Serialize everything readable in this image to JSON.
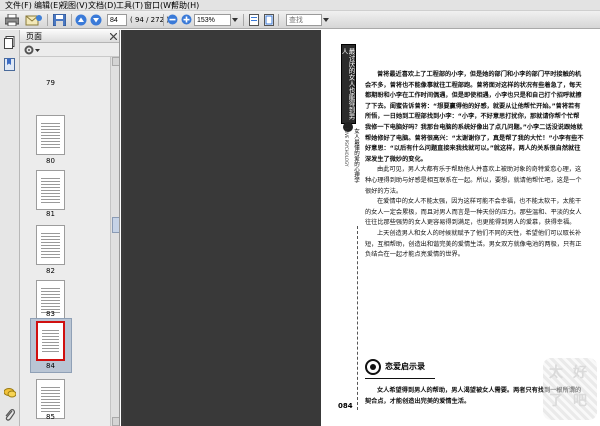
{
  "menu": [
    {
      "label": "文件(F)"
    },
    {
      "label": "编辑(E)"
    },
    {
      "label": "视图(V)"
    },
    {
      "label": "文档(D)"
    },
    {
      "label": "工具(T)"
    },
    {
      "label": "窗口(W)"
    },
    {
      "label": "帮助(H)"
    }
  ],
  "toolbar": {
    "page_current": "84",
    "page_total": "( 94 / 272 )",
    "zoom": "153%",
    "find_placeholder": "查找"
  },
  "panel": {
    "title": "页面",
    "thumbnails": [
      {
        "label": "79"
      },
      {
        "label": "80"
      },
      {
        "label": "81"
      },
      {
        "label": "82"
      },
      {
        "label": "83"
      },
      {
        "label": "84"
      },
      {
        "label": "85"
      }
    ],
    "selected_index": 5
  },
  "page": {
    "vertical_title": "最讨厌的女人也能得到男人",
    "vertical_subtitle": "女人最懂的爱的心理学",
    "vertical_subtitle_en": "LOVE PSYCHOLOGY",
    "page_number": "084",
    "paragraphs": [
      {
        "text": "曾将最近喜欢上了工程部的小李，但是她的部门和小李的部门平时接触的机会不多，曾将也不能像事就往工程部跑。曾将面对这样的状况有些着急了，每天都期盼和小李在工作时间偶遇，但是即使相遇，小李也只是和自己打个招呼就擦了下去。闺蜜告诉曾将：“想要赢得他的好感，就要从让他帮忙开始。”曾将若有所悟，一日她到工程部找到小李：“小李，不好意思打扰你，那就请你帮个忙帮我修一下电脑好吗？我那台电脑的系统好像出了点几问题。”小李二话没说跟她就帮她修好了电脑。曾将很高兴：“太谢谢你了，真是帮了我的大忙！”小李有些不好意思：“以后有什么问题直接来我找就可以。”就这样，两人的关系很自然就往深发生了微妙的变化。",
        "bold": true
      },
      {
        "text": "由此可见，男人大都有乐于帮助他人并喜欢上被助对象的奇特爱恋心理，这种心理得到助与好感是相互联系在一起。所以，要想，就请他帮忙吧，这是一个很好的方法。",
        "bold": false
      },
      {
        "text": "在爱情中的女人不能太强，因为这样可能不会幸福，也不能太软干，太能干的女人一定会累极，而且对男人而言是一种天份的压力。那些温和、平淡的女人往往比那些强势的女人更容易得到满足，也更能得到男人的爱慕，获得幸福。",
        "bold": false
      },
      {
        "text": "上天创造男人和女人的时候就赋予了他们不同的天性，希望他们可以取长补短，互相帮助，创造出和谐完美的爱情生活。男女双方就像电池的两极，只有正负结合在一起才能点亮爱情的世界。",
        "bold": false
      }
    ],
    "section_title": "恋爱启示录",
    "paragraphs2": [
      {
        "text": "女人希望得到男人的帮助，男人渴望被女人需要。两者只有找到一根所谓的契合点，才能创造出完美的爱情生活。",
        "bold": true
      }
    ],
    "seal_chars": [
      "太",
      "好",
      "了",
      "吧"
    ]
  },
  "colors": {
    "selection": "#d01010",
    "doc_background": "#393939"
  },
  "icons": [
    "print-icon",
    "email-icon",
    "save-icon",
    "page-up-icon",
    "page-down-icon",
    "zoom-out-icon",
    "zoom-in-icon",
    "fit-width-icon",
    "fit-page-icon",
    "pages-icon",
    "bookmarks-icon",
    "attachment-icon",
    "comment-icon",
    "options-icon"
  ]
}
